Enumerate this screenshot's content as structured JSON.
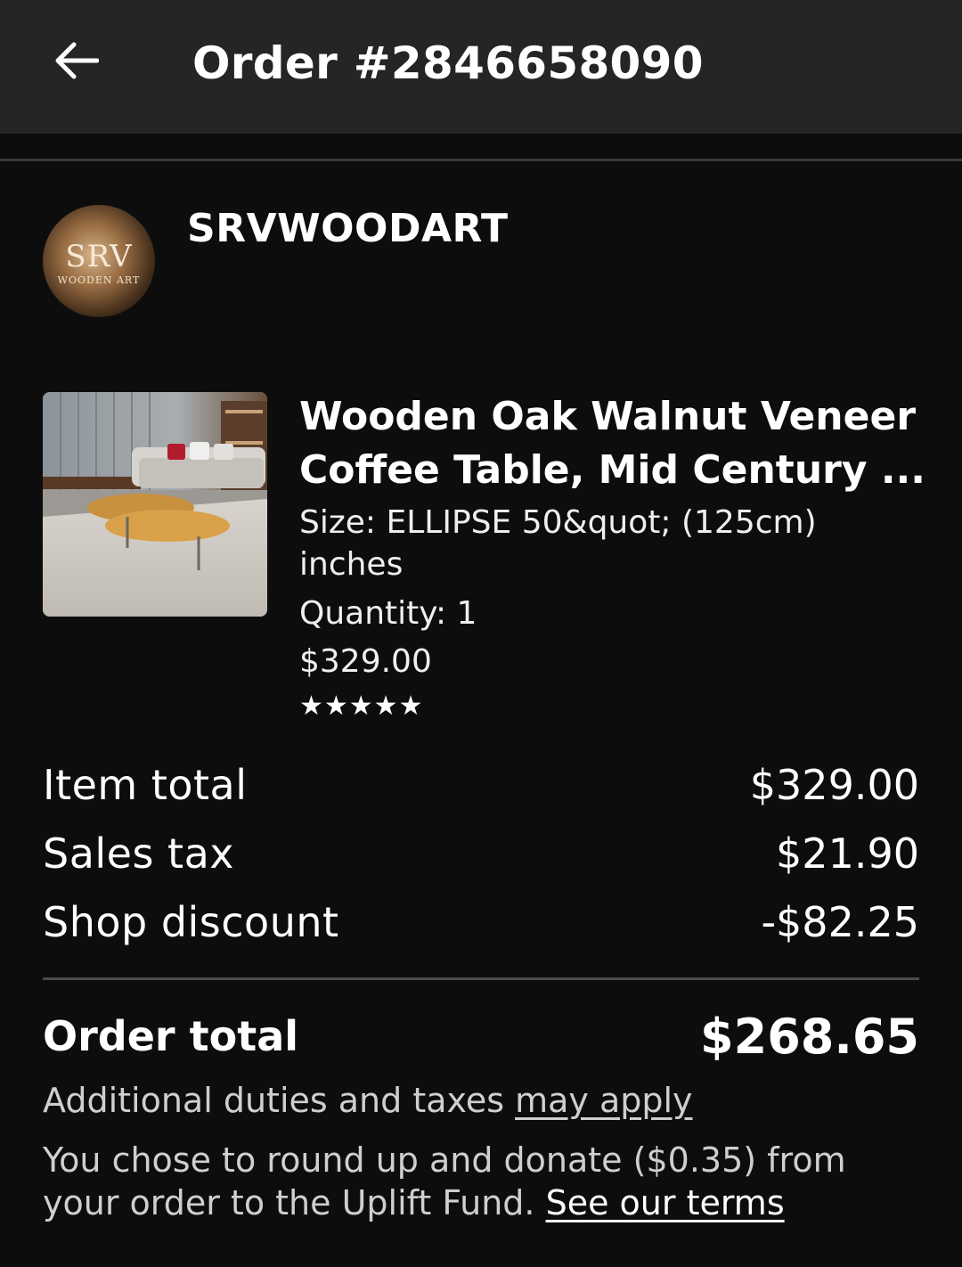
{
  "header": {
    "title": "Order #2846658090"
  },
  "shop": {
    "name": "SRVWOODART",
    "logo_text": "SRV",
    "logo_subtext": "WOODEN ART"
  },
  "product": {
    "title_line1": "Wooden Oak Walnut Veneer",
    "title_line2": "Coffee Table, Mid Century ...",
    "size_line1": "Size: ELLIPSE 50&quot; (125cm)",
    "size_line2": "inches",
    "quantity": "Quantity: 1",
    "price": "$329.00",
    "rating_stars": "★★★★★",
    "rating": 5
  },
  "summary": {
    "item_total_label": "Item total",
    "item_total_value": "$329.00",
    "sales_tax_label": "Sales tax",
    "sales_tax_value": "$21.90",
    "shop_discount_label": "Shop discount",
    "shop_discount_value": "-$82.25",
    "order_total_label": "Order total",
    "order_total_value": "$268.65"
  },
  "notes": {
    "duties_text": "Additional duties and taxes ",
    "duties_link": "may apply",
    "donate_line1": "You chose to round up and donate ($0.35) from",
    "donate_line2": "your order to the Uplift Fund. ",
    "terms_link": "See our terms"
  },
  "colors": {
    "background": "#0d0d0d",
    "header_bg": "#252525",
    "text": "#ffffff",
    "muted_text": "#cfcfcf"
  }
}
